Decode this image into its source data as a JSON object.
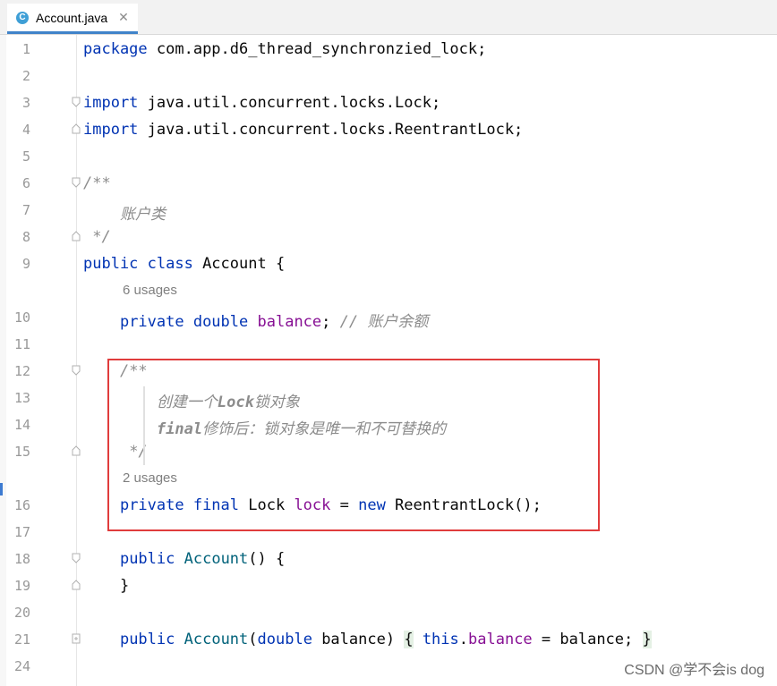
{
  "tab": {
    "icon": "C",
    "title": "Account.java",
    "close": "✕"
  },
  "lines": [
    {
      "num": "1",
      "tokens": [
        [
          "kw",
          "package"
        ],
        [
          "p",
          " com.app.d6_thread_synchronzied_lock;"
        ]
      ]
    },
    {
      "num": "2",
      "tokens": []
    },
    {
      "num": "3",
      "tokens": [
        [
          "kw",
          "import"
        ],
        [
          "p",
          " java.util.concurrent.locks.Lock;"
        ]
      ]
    },
    {
      "num": "4",
      "tokens": [
        [
          "kw",
          "import"
        ],
        [
          "p",
          " java.util.concurrent.locks.ReentrantLock;"
        ]
      ]
    },
    {
      "num": "5",
      "tokens": []
    },
    {
      "num": "6",
      "tokens": [
        [
          "cmt",
          "/**"
        ]
      ]
    },
    {
      "num": "7",
      "tokens": [
        [
          "cmt",
          "    账户类"
        ]
      ]
    },
    {
      "num": "8",
      "tokens": [
        [
          "cmt",
          " */"
        ]
      ]
    },
    {
      "num": "9",
      "tokens": [
        [
          "kw",
          "public class"
        ],
        [
          "p",
          " Account {"
        ]
      ]
    },
    {
      "num": "10",
      "tokens": [
        [
          "p",
          "    "
        ],
        [
          "kw",
          "private double"
        ],
        [
          "p",
          " "
        ],
        [
          "field",
          "balance"
        ],
        [
          "p",
          "; "
        ],
        [
          "cmt",
          "// 账户余额"
        ]
      ]
    },
    {
      "num": "11",
      "tokens": []
    },
    {
      "num": "12",
      "tokens": [
        [
          "p",
          "    "
        ],
        [
          "cmt",
          "/**"
        ]
      ]
    },
    {
      "num": "13",
      "tokens": [
        [
          "p",
          "        "
        ],
        [
          "cmt",
          "创建一个"
        ],
        [
          "cmt-tag",
          "Lock"
        ],
        [
          "cmt",
          "锁对象"
        ]
      ]
    },
    {
      "num": "14",
      "tokens": [
        [
          "p",
          "        "
        ],
        [
          "cmt-tag",
          "final"
        ],
        [
          "cmt",
          "修饰后：锁对象是唯一和不可替换的"
        ]
      ]
    },
    {
      "num": "15",
      "tokens": [
        [
          "p",
          "     "
        ],
        [
          "cmt",
          "*/"
        ]
      ]
    },
    {
      "num": "16",
      "tokens": [
        [
          "p",
          "    "
        ],
        [
          "kw",
          "private final"
        ],
        [
          "p",
          " Lock "
        ],
        [
          "field",
          "lock"
        ],
        [
          "p",
          " = "
        ],
        [
          "kw",
          "new"
        ],
        [
          "p",
          " ReentrantLock();"
        ]
      ]
    },
    {
      "num": "17",
      "tokens": []
    },
    {
      "num": "18",
      "tokens": [
        [
          "p",
          "    "
        ],
        [
          "kw",
          "public"
        ],
        [
          "p",
          " "
        ],
        [
          "method",
          "Account"
        ],
        [
          "p",
          "() {"
        ]
      ]
    },
    {
      "num": "19",
      "tokens": [
        [
          "p",
          "    }"
        ]
      ]
    },
    {
      "num": "20",
      "tokens": []
    },
    {
      "num": "21",
      "tokens": [
        [
          "p",
          "    "
        ],
        [
          "kw",
          "public"
        ],
        [
          "p",
          " "
        ],
        [
          "method",
          "Account"
        ],
        [
          "p",
          "("
        ],
        [
          "kw",
          "double"
        ],
        [
          "p",
          " balance) "
        ],
        [
          "hl",
          "{"
        ],
        [
          "p",
          " "
        ],
        [
          "kw",
          "this"
        ],
        [
          "p",
          "."
        ],
        [
          "field",
          "balance"
        ],
        [
          "p",
          " = balance; "
        ],
        [
          "hl",
          "}"
        ]
      ]
    },
    {
      "num": "24",
      "tokens": []
    }
  ],
  "usages": {
    "balance": "6 usages",
    "lock": "2 usages"
  },
  "watermark": "CSDN @学不会is dog",
  "colors": {
    "keyword": "#0033b3",
    "field": "#871094",
    "method": "#00627a",
    "comment": "#8c8c8c",
    "highlight_box": "#e03c3c"
  },
  "icons": {
    "tab": "java-class-icon",
    "fold": "fold-marker-icon",
    "close": "close-icon"
  }
}
